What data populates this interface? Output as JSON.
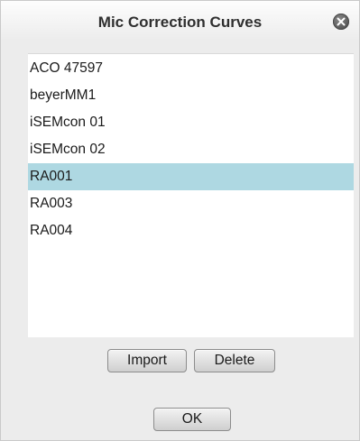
{
  "dialog": {
    "title": "Mic Correction Curves",
    "close_icon": "close-circle-icon"
  },
  "list": {
    "items": [
      {
        "label": "ACO 47597",
        "selected": false
      },
      {
        "label": "beyerMM1",
        "selected": false
      },
      {
        "label": "iSEMcon 01",
        "selected": false
      },
      {
        "label": "iSEMcon 02",
        "selected": false
      },
      {
        "label": "RA001",
        "selected": true
      },
      {
        "label": "RA003",
        "selected": false
      },
      {
        "label": "RA004",
        "selected": false
      }
    ],
    "selection_color": "#aed8e2"
  },
  "buttons": {
    "import_label": "Import",
    "delete_label": "Delete",
    "ok_label": "OK"
  }
}
